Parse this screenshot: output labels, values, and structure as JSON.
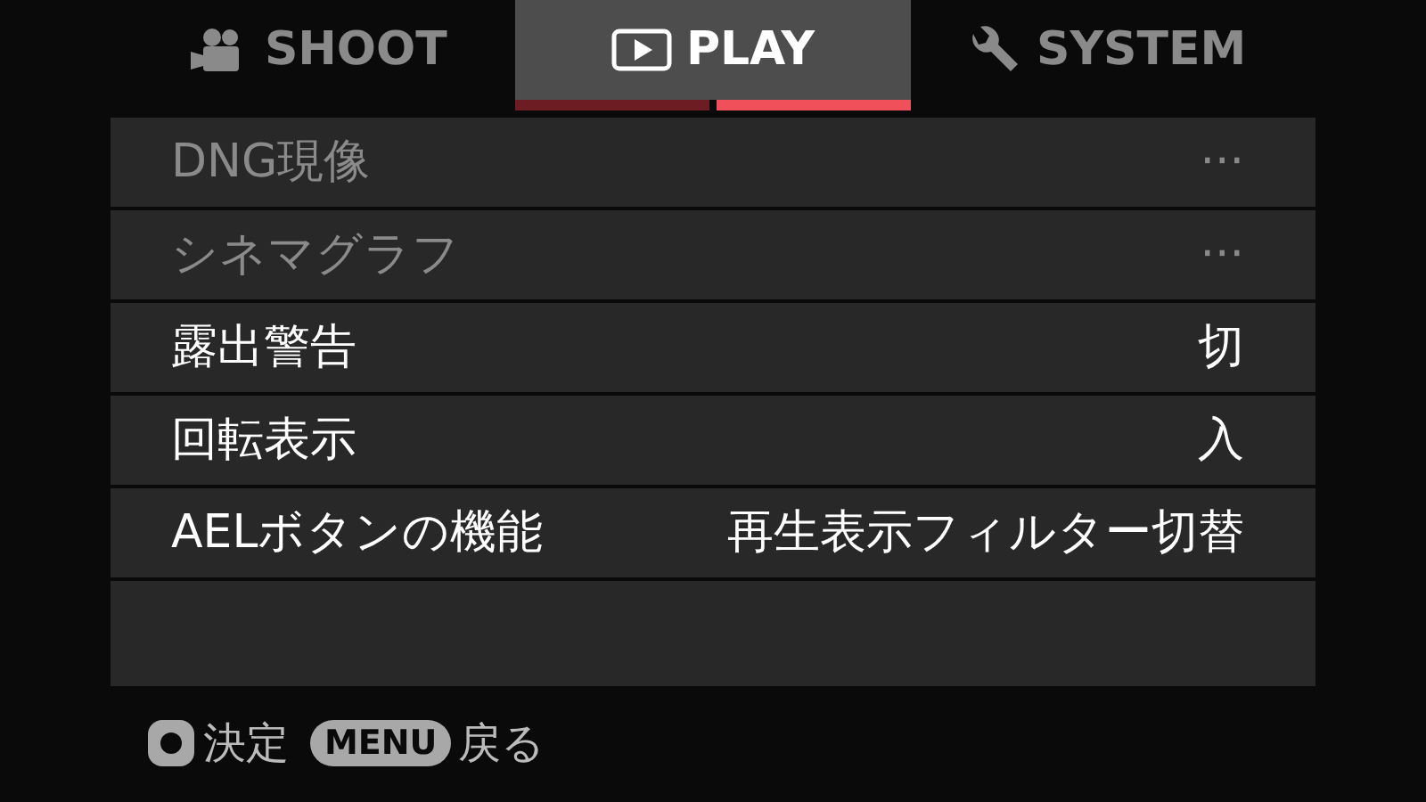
{
  "tabs": [
    {
      "label": "SHOOT",
      "kind": "camera",
      "selected": false
    },
    {
      "label": "PLAY",
      "kind": "play",
      "selected": true
    },
    {
      "label": "SYSTEM",
      "kind": "wrench",
      "selected": false
    }
  ],
  "pages": [
    {
      "selected": false
    },
    {
      "selected": true
    }
  ],
  "menu_items": [
    {
      "label": "DNG現像",
      "value": "···",
      "disabled": true
    },
    {
      "label": "シネマグラフ",
      "value": "···",
      "disabled": true
    },
    {
      "label": "露出警告",
      "value": "切",
      "disabled": false
    },
    {
      "label": "回転表示",
      "value": "入",
      "disabled": false
    },
    {
      "label": "AELボタンの機能",
      "value": "再生表示フィルター切替",
      "disabled": false
    }
  ],
  "footer": [
    {
      "kind": "dot",
      "label": "決定"
    },
    {
      "key": "MENU",
      "kind": "pill",
      "label": "戻る"
    }
  ]
}
